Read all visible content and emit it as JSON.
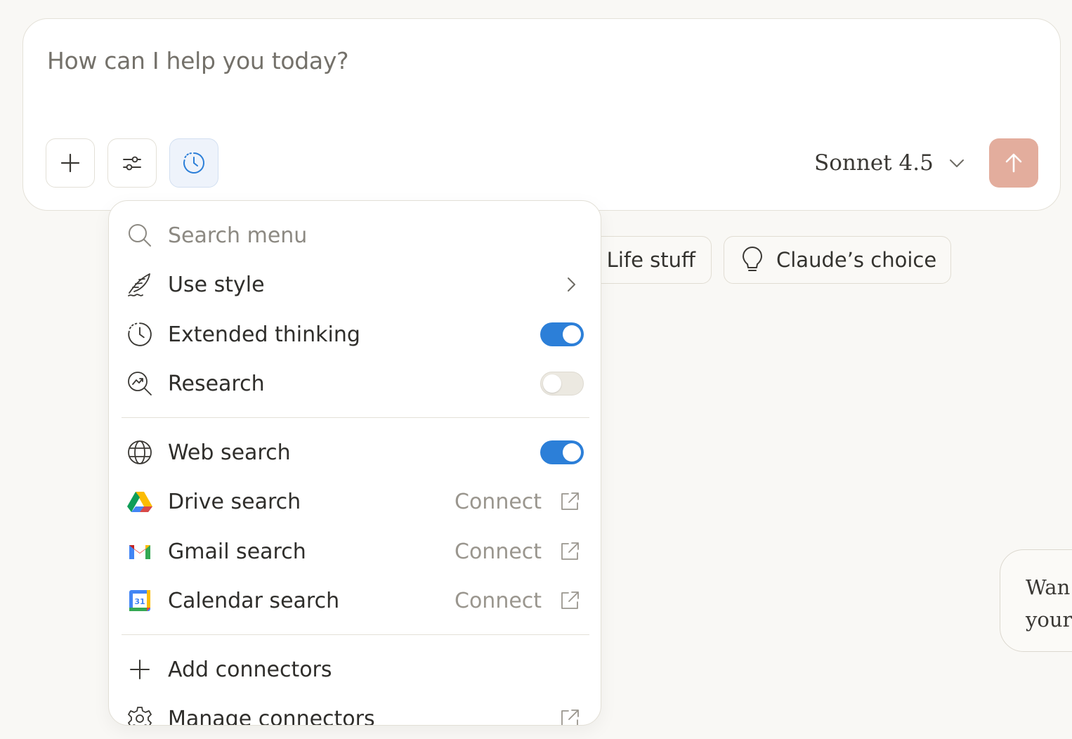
{
  "composer": {
    "placeholder": "How can I help you today?",
    "model": "Sonnet 4.5"
  },
  "chips": [
    {
      "label": "Life stuff"
    },
    {
      "label": "Claude’s choice"
    }
  ],
  "hint_card": {
    "line1": "Wan",
    "line2": "your"
  },
  "menu": {
    "search_placeholder": "Search menu",
    "items": [
      {
        "label": "Use style",
        "icon": "feather-icon",
        "control": "submenu"
      },
      {
        "label": "Extended thinking",
        "icon": "clock-icon",
        "control": "toggle",
        "on": true
      },
      {
        "label": "Research",
        "icon": "research-icon",
        "control": "toggle",
        "on": false
      },
      {
        "label": "Web search",
        "icon": "globe-icon",
        "control": "toggle",
        "on": true
      },
      {
        "label": "Drive search",
        "icon": "google-drive-icon",
        "control": "connect",
        "action": "Connect"
      },
      {
        "label": "Gmail search",
        "icon": "gmail-icon",
        "control": "connect",
        "action": "Connect"
      },
      {
        "label": "Calendar search",
        "icon": "google-calendar-icon",
        "control": "connect",
        "action": "Connect",
        "icon_text": "31"
      },
      {
        "label": "Add connectors",
        "icon": "plus-icon",
        "control": "none"
      },
      {
        "label": "Manage connectors",
        "icon": "gear-icon",
        "control": "external"
      }
    ]
  },
  "colors": {
    "background": "#f9f8f5",
    "toggle_on": "#2c7fd8",
    "send_button": "#e3ad9d",
    "active_tool": "#eef3fb"
  }
}
